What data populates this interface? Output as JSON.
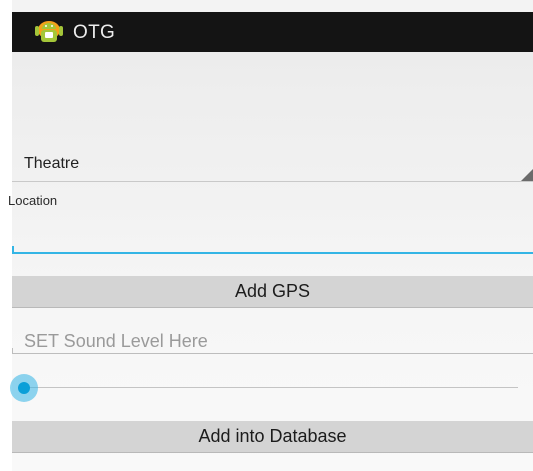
{
  "action_bar": {
    "title": "OTG",
    "icon": "android-app-icon",
    "background": "#141414"
  },
  "spinner": {
    "selected": "Theatre"
  },
  "location": {
    "label": "Location",
    "value": ""
  },
  "add_gps": {
    "label": "Add GPS"
  },
  "sound_level": {
    "placeholder": "SET Sound Level Here",
    "value": ""
  },
  "seekbar": {
    "progress": 0
  },
  "add_db": {
    "label": "Add into Database"
  },
  "colors": {
    "accent": "#33b5e5",
    "button": "#d4d4d4"
  }
}
